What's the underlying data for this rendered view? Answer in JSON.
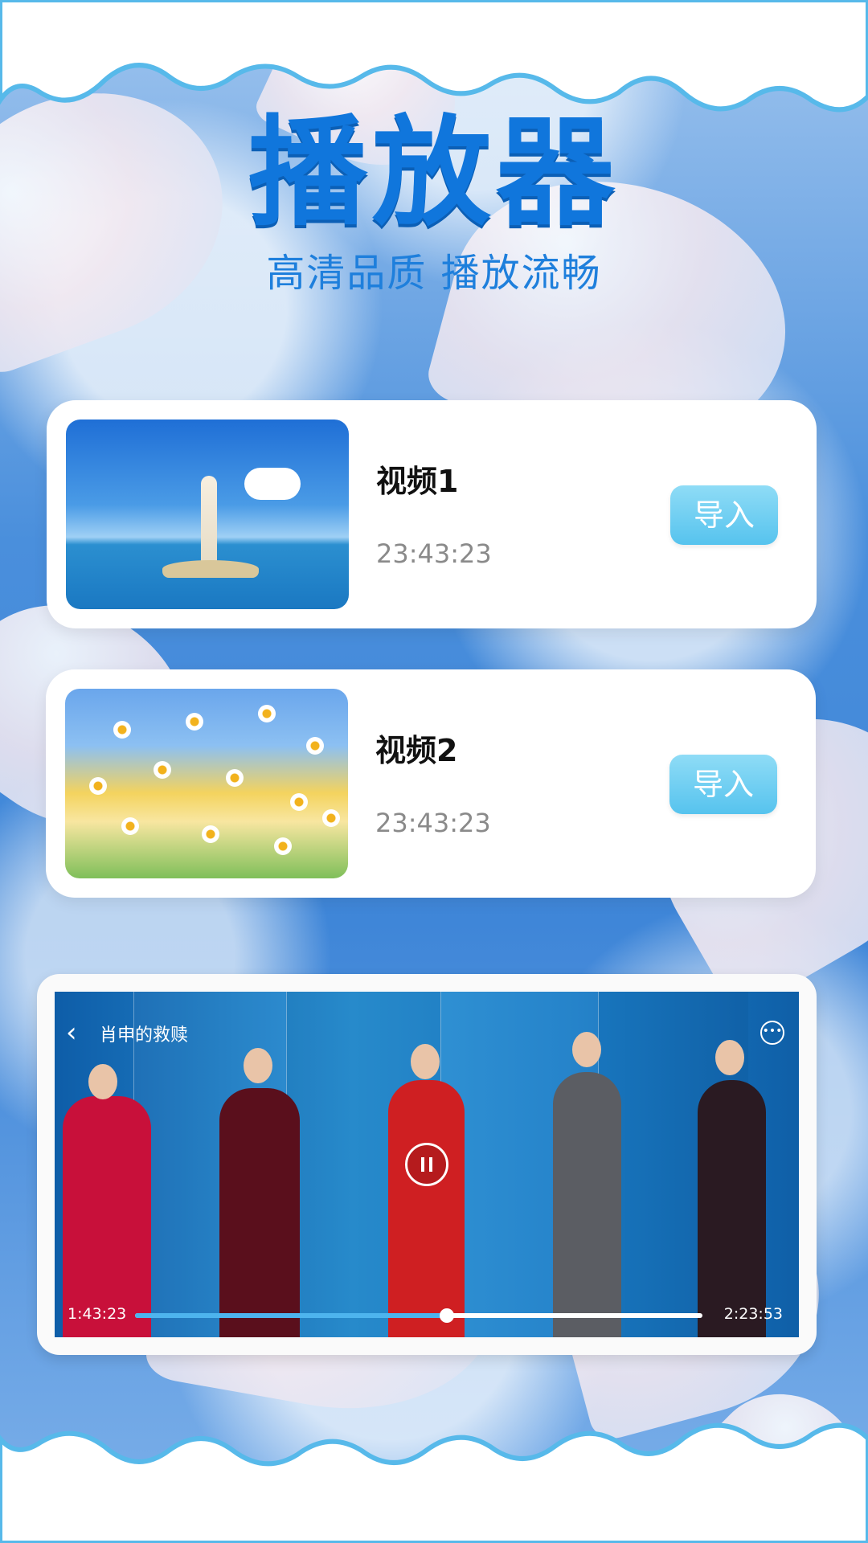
{
  "header": {
    "title": "播放器",
    "subtitle": "高清品质 播放流畅"
  },
  "videos": [
    {
      "name": "视频1",
      "duration": "23:43:23",
      "import_label": "导入",
      "thumbnail": "statue-by-sea-image"
    },
    {
      "name": "视频2",
      "duration": "23:43:23",
      "import_label": "导入",
      "thumbnail": "daisy-field-image"
    }
  ],
  "player": {
    "title": "肖申的救赎",
    "current_time": "1:43:23",
    "total_time": "2:23:53",
    "progress": 0.55,
    "back_icon": "chevron-left-icon",
    "more_icon": "more-dots-icon",
    "pause_icon": "pause-icon"
  },
  "colors": {
    "title": "#1076dc",
    "accent": "#56c3ee",
    "background": "#3f86d8"
  }
}
